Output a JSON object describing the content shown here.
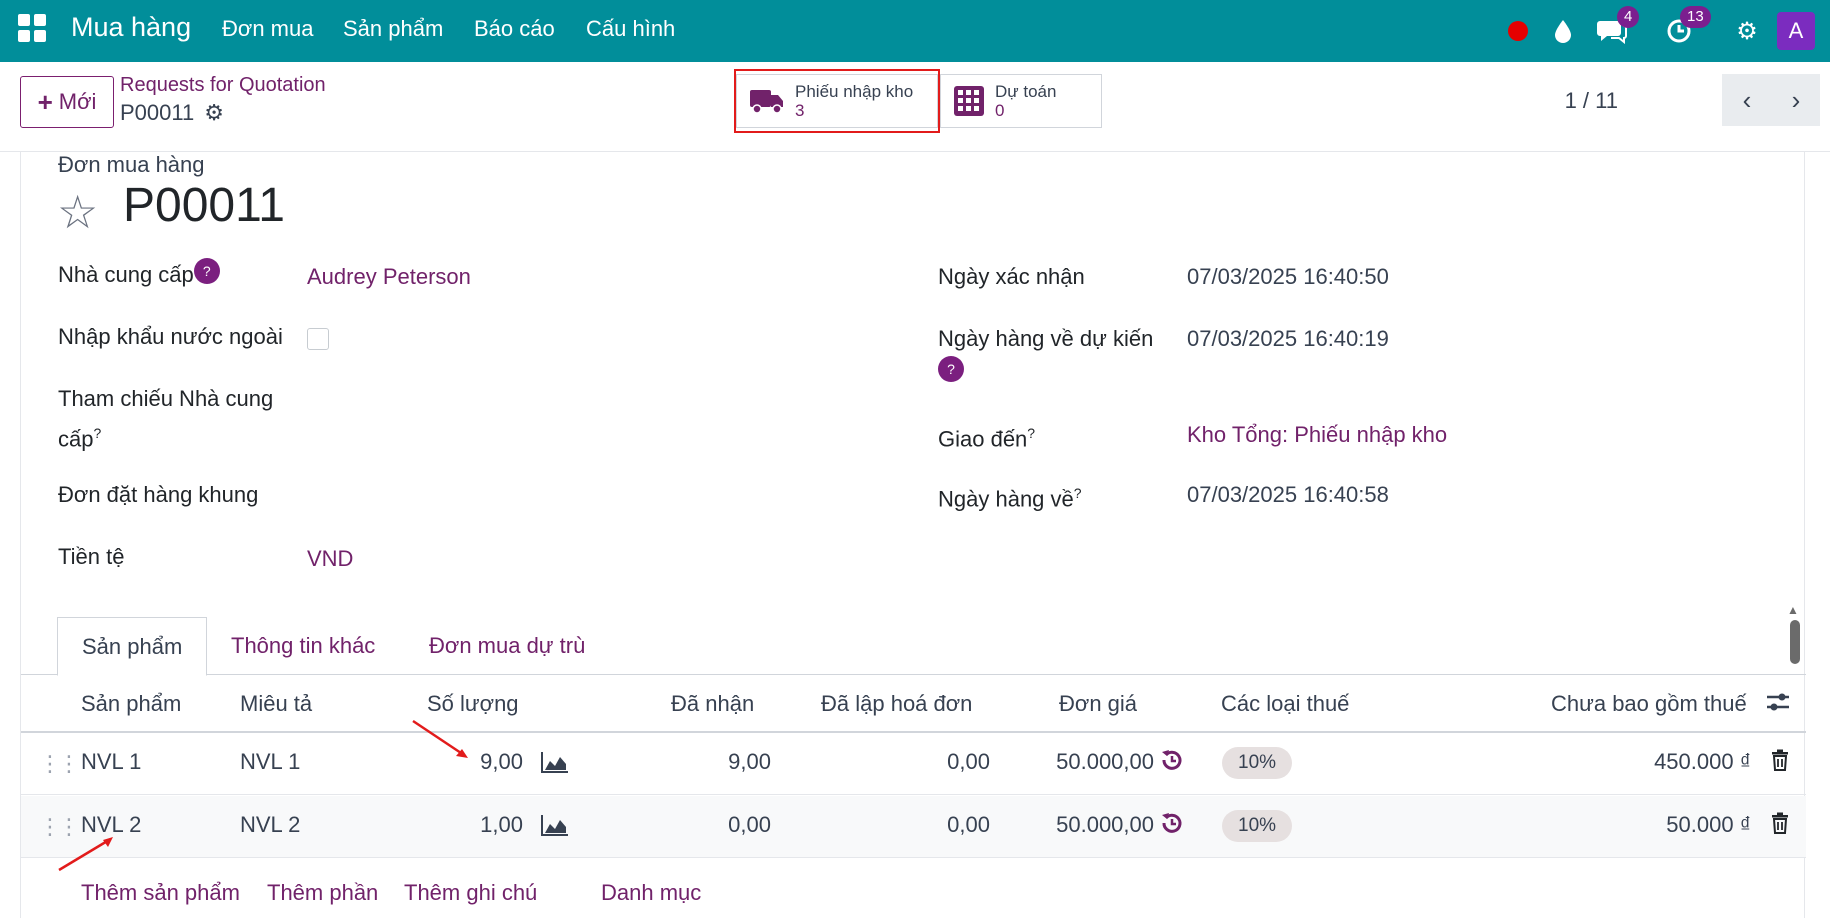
{
  "navbar": {
    "brand": "Mua hàng",
    "menu": [
      "Đơn mua",
      "Sản phẩm",
      "Báo cáo",
      "Cấu hình"
    ],
    "messages_count": "4",
    "activities_count": "13",
    "avatar_letter": "A"
  },
  "control": {
    "new_label": "Mới",
    "breadcrumb": "Requests for Quotation",
    "record_name": "P00011",
    "smart_buttons": [
      {
        "label": "Phiếu nhập kho",
        "value": "3"
      },
      {
        "label": "Dự toán",
        "value": "0"
      }
    ],
    "pager": "1 / 11"
  },
  "form": {
    "doc_type": "Đơn mua hàng",
    "title": "P00011",
    "left": {
      "vendor_label": "Nhà cung cấp",
      "vendor_value": "Audrey Peterson",
      "import_label": "Nhập khẩu nước ngoài",
      "vendor_ref_label_1": "Tham chiếu Nhà cung",
      "vendor_ref_label_2": "cấp",
      "blanket_label": "Đơn đặt hàng khung",
      "currency_label": "Tiền tệ",
      "currency_value": "VND"
    },
    "right": {
      "confirm_date_label": "Ngày xác nhận",
      "confirm_date_value": "07/03/2025 16:40:50",
      "expected_label": "Ngày hàng về dự kiến",
      "expected_value": "07/03/2025 16:40:19",
      "deliver_to_label": "Giao đến",
      "deliver_to_value": "Kho Tổng: Phiếu nhập kho",
      "arrival_label": "Ngày hàng về",
      "arrival_value": "07/03/2025 16:40:58"
    },
    "help_mark": "?",
    "sup_mark": "?"
  },
  "tabs": [
    "Sản phẩm",
    "Thông tin khác",
    "Đơn mua dự trù"
  ],
  "table": {
    "headers": [
      "Sản phẩm",
      "Miêu tả",
      "Số lượng",
      "Đã nhận",
      "Đã lập hoá đơn",
      "Đơn giá",
      "Các loại thuế",
      "Chưa bao gồm thuế"
    ],
    "rows": [
      {
        "product": "NVL 1",
        "description": "NVL 1",
        "qty": "9,00",
        "received": "9,00",
        "billed": "0,00",
        "price": "50.000,00",
        "tax": "10%",
        "subtotal": "450.000 ₫"
      },
      {
        "product": "NVL 2",
        "description": "NVL 2",
        "qty": "1,00",
        "received": "0,00",
        "billed": "0,00",
        "price": "50.000,00",
        "tax": "10%",
        "subtotal": "50.000 ₫"
      }
    ],
    "add_links": [
      "Thêm sản phẩm",
      "Thêm phần",
      "Thêm ghi chú",
      "Danh mục"
    ]
  }
}
